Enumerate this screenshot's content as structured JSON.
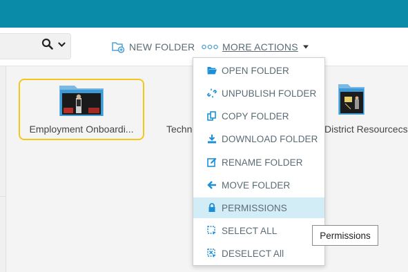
{
  "toolbar": {
    "search_icon": "search-icon",
    "new_folder_label": "NEW FOLDER",
    "more_actions_label": "MORE ACTIONS"
  },
  "folders": [
    {
      "name": "Employment Onboardi...",
      "selected": true
    },
    {
      "name": "Techn",
      "selected": false
    },
    {
      "name": "District Resourcecs",
      "selected": false
    }
  ],
  "menu": {
    "items": [
      {
        "label": "OPEN FOLDER",
        "icon": "folder-open-icon"
      },
      {
        "label": "UNPUBLISH FOLDER",
        "icon": "unlink-icon"
      },
      {
        "label": "COPY FOLDER",
        "icon": "copy-icon"
      },
      {
        "label": "DOWNLOAD FOLDER",
        "icon": "download-icon"
      },
      {
        "label": "RENAME FOLDER",
        "icon": "edit-icon"
      },
      {
        "label": "MOVE FOLDER",
        "icon": "arrow-left-icon"
      },
      {
        "label": "PERMISSIONS",
        "icon": "lock-icon",
        "highlighted": true
      },
      {
        "label": "SELECT ALL",
        "icon": "select-all-icon"
      },
      {
        "label": "DESELECT All",
        "icon": "deselect-all-icon"
      }
    ]
  },
  "tooltip": "Permissions",
  "colors": {
    "topbar": "#0a8ba7",
    "accent": "#1a8fd8",
    "selection_border": "#f5c518",
    "highlight": "#d3edf7"
  }
}
